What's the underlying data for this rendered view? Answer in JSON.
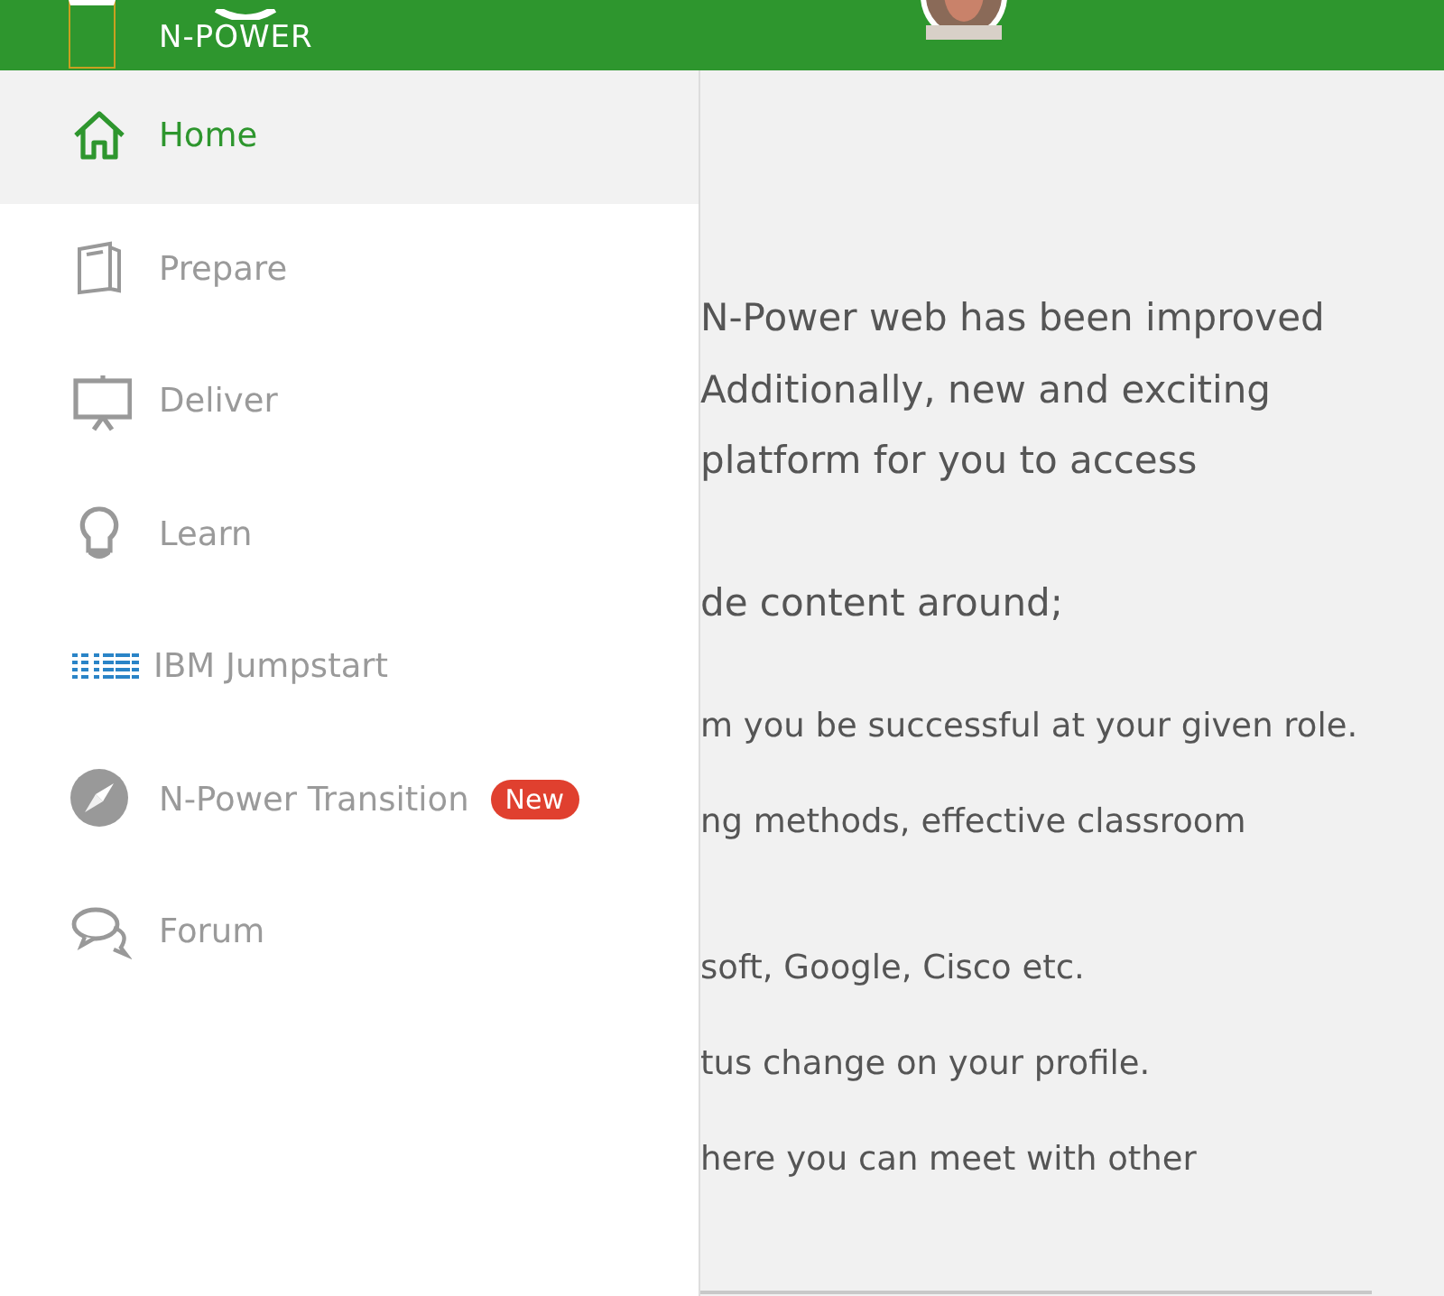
{
  "header": {
    "logo": "N-POWER"
  },
  "drawer": {
    "items": [
      {
        "kind": "home",
        "label": "Home",
        "selected": true
      },
      {
        "kind": "book",
        "label": "Prepare",
        "selected": false
      },
      {
        "kind": "easel",
        "label": "Deliver",
        "selected": false
      },
      {
        "kind": "bulb",
        "label": "Learn",
        "selected": false
      },
      {
        "kind": "ibm",
        "label": "IBM Jumpstart",
        "selected": false
      },
      {
        "kind": "compass",
        "label": "N-Power Transition",
        "selected": false,
        "badge": "New"
      },
      {
        "kind": "chat",
        "label": "Forum",
        "selected": false
      }
    ]
  },
  "content": {
    "paragraphs": [
      {
        "kind": "lead",
        "lines": [
          "N-Power web has been improved",
          "Additionally, new and exciting",
          "platform for you to access"
        ]
      },
      {
        "kind": "lead",
        "lines": [
          "de content around;"
        ]
      },
      {
        "kind": "item",
        "lines": [
          "m you be successful at your given role."
        ]
      },
      {
        "kind": "item",
        "lines": [
          "ng methods, effective classroom"
        ]
      },
      {
        "kind": "item",
        "lines": [
          "soft, Google, Cisco etc."
        ]
      },
      {
        "kind": "item",
        "lines": [
          "tus change on your profile."
        ]
      },
      {
        "kind": "item",
        "lines": [
          "here you can meet with other"
        ]
      }
    ]
  }
}
